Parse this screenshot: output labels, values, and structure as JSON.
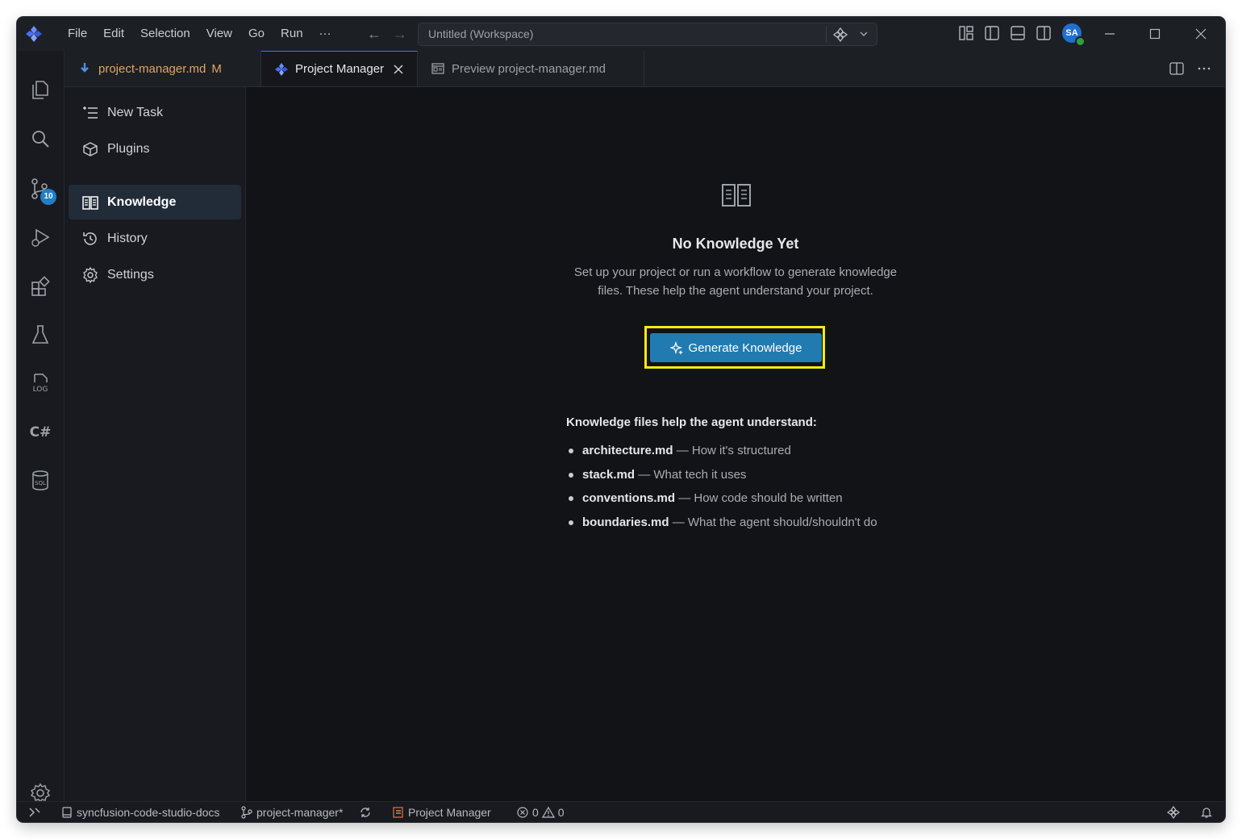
{
  "titlebar": {
    "menu": [
      "File",
      "Edit",
      "Selection",
      "View",
      "Go",
      "Run",
      "···"
    ],
    "search_text": "Untitled (Workspace)",
    "avatar": "SA"
  },
  "tabs": [
    {
      "label": "project-manager.md",
      "status": "M"
    },
    {
      "label": "Project Manager"
    },
    {
      "label": "Preview project-manager.md"
    }
  ],
  "activity_badge": "10",
  "sidebar": {
    "items": [
      {
        "label": "New Task",
        "icon": "list-add-icon"
      },
      {
        "label": "Plugins",
        "icon": "package-icon"
      },
      {
        "label": "Knowledge",
        "icon": "book-icon",
        "active": true
      },
      {
        "label": "History",
        "icon": "history-icon"
      },
      {
        "label": "Settings",
        "icon": "gear-icon"
      }
    ]
  },
  "main": {
    "empty_title": "No Knowledge Yet",
    "empty_desc": "Set up your project or run a workflow to generate knowledge files. These help the agent understand your project.",
    "generate_button": "Generate Knowledge",
    "help_title": "Knowledge files help the agent understand:",
    "help_items": [
      {
        "file": "architecture.md",
        "desc": "— How it's structured"
      },
      {
        "file": "stack.md",
        "desc": "— What tech it uses"
      },
      {
        "file": "conventions.md",
        "desc": "— How code should be written"
      },
      {
        "file": "boundaries.md",
        "desc": "— What the agent should/shouldn't do"
      }
    ]
  },
  "statusbar": {
    "folder": "syncfusion-code-studio-docs",
    "branch": "project-manager*",
    "view": "Project Manager",
    "errors": "0",
    "warnings": "0"
  },
  "colors": {
    "accent": "#217bb0",
    "highlight": "#f5ea14",
    "modified": "#e2a45f",
    "background": "#111316"
  }
}
